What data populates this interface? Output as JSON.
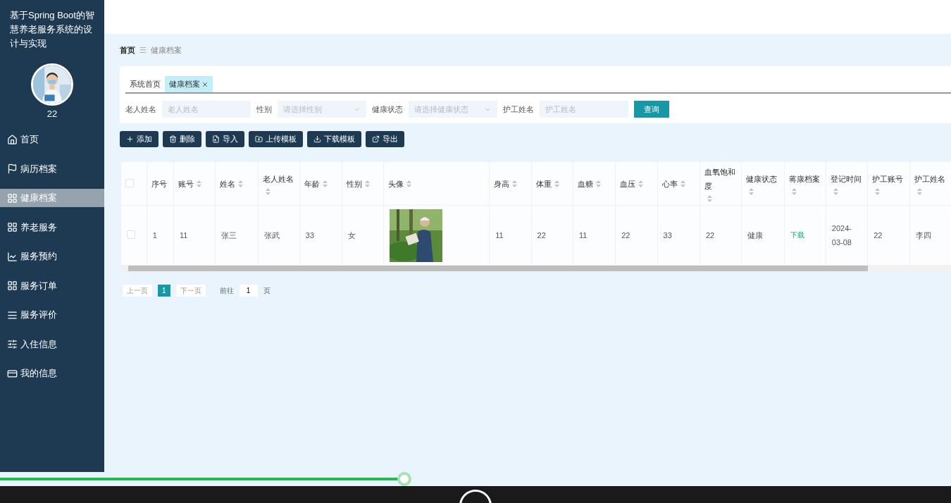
{
  "sidebar": {
    "title": "基于Spring Boot的智慧养老服务系统的设计与实现",
    "avatar": {
      "kind": "picture"
    },
    "username": "22",
    "items": [
      {
        "label": "首页",
        "selected": false
      },
      {
        "label": "病历档案",
        "selected": false
      },
      {
        "label": "健康档案",
        "selected": true
      },
      {
        "label": "养老服务",
        "selected": false
      },
      {
        "label": "服务预约",
        "selected": false
      },
      {
        "label": "服务订单",
        "selected": false
      },
      {
        "label": "服务评价",
        "selected": false
      },
      {
        "label": "入住信息",
        "selected": false
      },
      {
        "label": "我的信息",
        "selected": false
      }
    ]
  },
  "breadcrumb": {
    "home": "首页",
    "separator": "☰",
    "current": "健康档案"
  },
  "tabs": [
    {
      "label": "系统首页",
      "selected": false,
      "closable": false
    },
    {
      "label": "健康档案",
      "selected": true,
      "closable": true
    }
  ],
  "filters": [
    {
      "kind": "input",
      "label": "老人姓名",
      "placeholder": "老人姓名"
    },
    {
      "kind": "select",
      "label": "性别",
      "placeholder": "请选择性别"
    },
    {
      "kind": "select",
      "label": "健康状态",
      "placeholder": "请选择健康状态"
    },
    {
      "kind": "input",
      "label": "护工姓名",
      "placeholder": "护工姓名"
    }
  ],
  "search_button": "查询",
  "actions": [
    "添加",
    "删除",
    "导入",
    "上传模板",
    "下载模板",
    "导出"
  ],
  "table": {
    "select_all": {
      "checked": false
    },
    "columns": [
      {
        "label": "序号",
        "sortable": false
      },
      {
        "label": "账号",
        "sortable": true
      },
      {
        "label": "姓名",
        "sortable": true
      },
      {
        "label": "老人姓名",
        "sortable": true
      },
      {
        "label": "年龄",
        "sortable": true
      },
      {
        "label": "性别",
        "sortable": true
      },
      {
        "label": "头像",
        "sortable": true
      },
      {
        "label": "身高",
        "sortable": true
      },
      {
        "label": "体重",
        "sortable": true
      },
      {
        "label": "血糖",
        "sortable": true
      },
      {
        "label": "血压",
        "sortable": true
      },
      {
        "label": "心率",
        "sortable": true
      },
      {
        "label": "血氧饱和度",
        "sortable": true
      },
      {
        "label": "健康状态",
        "sortable": true
      },
      {
        "label": "蒋康档案",
        "sortable": true
      },
      {
        "label": "登记时间",
        "sortable": true
      },
      {
        "label": "护工账号",
        "sortable": true
      },
      {
        "label": "护工姓名",
        "sortable": true
      }
    ],
    "rows": [
      {
        "checked": false,
        "cells": [
          {
            "kind": "text",
            "text": "1"
          },
          {
            "kind": "text",
            "text": "11"
          },
          {
            "kind": "text",
            "text": "张三"
          },
          {
            "kind": "text",
            "text": "张武"
          },
          {
            "kind": "text",
            "text": "33"
          },
          {
            "kind": "text",
            "text": "女"
          },
          {
            "kind": "picture"
          },
          {
            "kind": "text",
            "text": "11"
          },
          {
            "kind": "text",
            "text": "22"
          },
          {
            "kind": "text",
            "text": "11"
          },
          {
            "kind": "text",
            "text": "22"
          },
          {
            "kind": "text",
            "text": "33"
          },
          {
            "kind": "text",
            "text": "22"
          },
          {
            "kind": "text",
            "text": "健康"
          },
          {
            "kind": "link",
            "text": "下载"
          },
          {
            "kind": "text",
            "text": "2024-03-08"
          },
          {
            "kind": "text",
            "text": "22"
          },
          {
            "kind": "text",
            "text": "李四"
          }
        ]
      }
    ]
  },
  "pagination": {
    "prev": "上一页",
    "pages": [
      {
        "label": "1",
        "selected": true
      }
    ],
    "next": "下一页",
    "goto_label": "前往",
    "goto_value": "1",
    "goto_suffix": "页"
  },
  "player": {
    "progress": {
      "level": 0.425
    }
  }
}
